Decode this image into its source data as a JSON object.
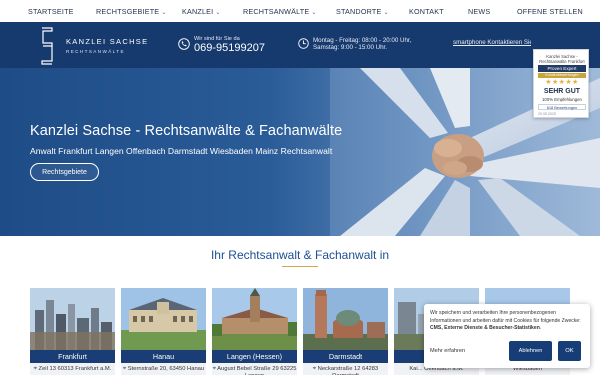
{
  "nav": {
    "items": [
      {
        "label": "STARTSEITE",
        "has_dropdown": false
      },
      {
        "label": "RECHTSGEBIETE",
        "has_dropdown": true
      },
      {
        "label": "KANZLEI",
        "has_dropdown": true
      },
      {
        "label": "RECHTSANWÄLTE",
        "has_dropdown": true
      },
      {
        "label": "STANDORTE",
        "has_dropdown": true
      },
      {
        "label": "KONTAKT",
        "has_dropdown": false
      },
      {
        "label": "NEWS",
        "has_dropdown": false
      },
      {
        "label": "OFFENE STELLEN",
        "has_dropdown": false
      }
    ]
  },
  "header": {
    "logo_line1": "KANZLEI SACHSE",
    "logo_line2": "RECHTSANWÄLTE",
    "phone_caption": "Wir sind für Sie da",
    "phone_number": "069-95199207",
    "hours_line1": "Montag - Freitag: 08:00 - 20:00 Uhr,",
    "hours_line2": "Samstag: 9:00 - 15:00 Uhr.",
    "smartphone_link": "smartphone Kontaktieren Sie uns"
  },
  "hero": {
    "title": "Kanzlei Sachse - Rechtsanwälte & Fachanwälte",
    "subtitle": "Anwalt Frankfurt Langen Offenbach Darmstadt Wiesbaden Mainz Rechtsanwalt",
    "button": "Rechtsgebiete"
  },
  "proven_expert": {
    "title": "Kanzlei Sachse - Rechtsanwälte Frankfurt ...",
    "brand": "Proven Expert",
    "rating_label": "Kundenbewertungen",
    "stars": "★★★★★",
    "verdict": "SEHR GUT",
    "recommendation": "100% Empfehlungen",
    "reviews": "618 Bewertungen",
    "date": "20.05.2025"
  },
  "locations": {
    "title": "Ihr Rechtsanwalt & Fachanwalt in",
    "cards": [
      {
        "city": "Frankfurt",
        "address": "Zeil 13 60313 Frankfurt a.M."
      },
      {
        "city": "Hanau",
        "address": "Sternstraße 20, 63450 Hanau"
      },
      {
        "city": "Langen (Hessen)",
        "address": "August Bebel Straße 29 63225 Langen"
      },
      {
        "city": "Darmstadt",
        "address": "Neckarstraße 12 64283 Darmstadt"
      },
      {
        "city": "O",
        "address": "Kai... Offenbach a.M."
      },
      {
        "city": "",
        "address": "Wiesbaden"
      }
    ]
  },
  "cookie": {
    "text_plain": "Wir speichern und verarbeiten Ihre personenbezogenen Informationen und arbeiten dafür mit Cookies für folgende Zwecke: ",
    "text_bold": "CMS, Externe Dienste & Besucher-Statistiken",
    "text_end": ".",
    "more": "Mehr erfahren",
    "deny": "Ablehnen",
    "ok": "OK"
  }
}
